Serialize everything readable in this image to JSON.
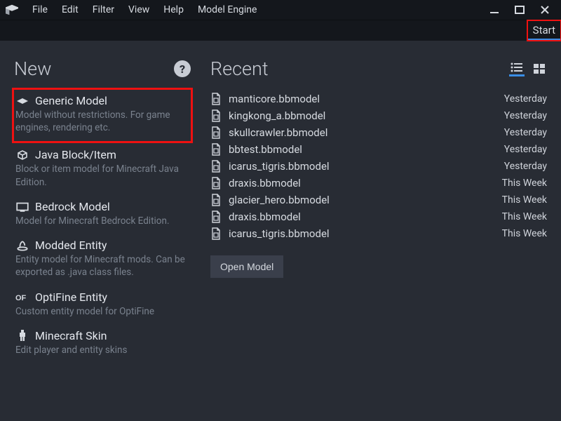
{
  "menu": {
    "file": "File",
    "edit": "Edit",
    "filter": "Filter",
    "view": "View",
    "help": "Help",
    "model_engine": "Model Engine"
  },
  "tabs": {
    "start": "Start"
  },
  "new_section": {
    "title": "New",
    "help_glyph": "?",
    "items": [
      {
        "title": "Generic Model",
        "desc": "Model without restrictions. For game engines, rendering etc."
      },
      {
        "title": "Java Block/Item",
        "desc": "Block or item model for Minecraft Java Edition."
      },
      {
        "title": "Bedrock Model",
        "desc": "Model for Minecraft Bedrock Edition."
      },
      {
        "title": "Modded Entity",
        "desc": "Entity model for Minecraft mods. Can be exported as .java class files."
      },
      {
        "title": "OptiFine Entity",
        "desc": "Custom entity model for OptiFine"
      },
      {
        "title": "Minecraft Skin",
        "desc": "Edit player and entity skins"
      }
    ]
  },
  "recent_section": {
    "title": "Recent",
    "open_button": "Open Model",
    "items": [
      {
        "name": "manticore.bbmodel",
        "time": "Yesterday"
      },
      {
        "name": "kingkong_a.bbmodel",
        "time": "Yesterday"
      },
      {
        "name": "skullcrawler.bbmodel",
        "time": "Yesterday"
      },
      {
        "name": "bbtest.bbmodel",
        "time": "Yesterday"
      },
      {
        "name": "icarus_tigris.bbmodel",
        "time": "Yesterday"
      },
      {
        "name": "draxis.bbmodel",
        "time": "This Week"
      },
      {
        "name": "glacier_hero.bbmodel",
        "time": "This Week"
      },
      {
        "name": "draxis.bbmodel",
        "time": "This Week"
      },
      {
        "name": "icarus_tigris.bbmodel",
        "time": "This Week"
      }
    ]
  }
}
